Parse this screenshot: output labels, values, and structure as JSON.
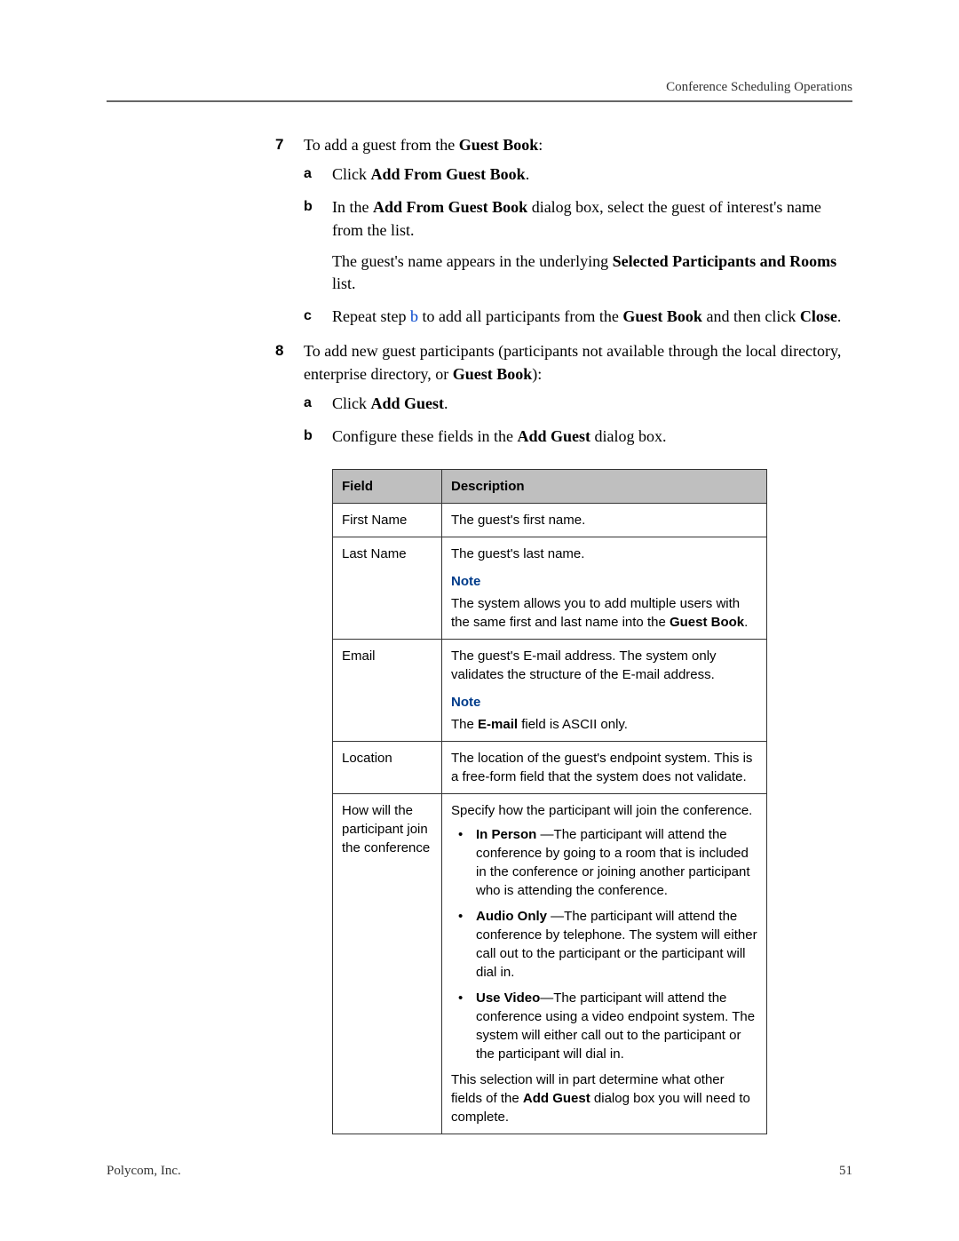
{
  "header": {
    "running_title": "Conference Scheduling Operations"
  },
  "steps": {
    "s7": {
      "num": "7",
      "intro_pre": "To add a guest from the ",
      "intro_bold": "Guest Book",
      "intro_post": ":",
      "a": {
        "letter": "a",
        "pre": "Click ",
        "bold": "Add From Guest Book",
        "post": "."
      },
      "b": {
        "letter": "b",
        "pre": "In the ",
        "bold": "Add From Guest Book",
        "post": " dialog box, select the guest of interest's name from the list.",
        "para2_pre": "The guest's name appears in the underlying ",
        "para2_bold": "Selected Participants and Rooms",
        "para2_post": " list."
      },
      "c": {
        "letter": "c",
        "text1": "Repeat step ",
        "link": "b",
        "text2": " to add all participants from the ",
        "bold1": "Guest Book",
        "text3": " and then click ",
        "bold2": "Close",
        "text4": "."
      }
    },
    "s8": {
      "num": "8",
      "intro_pre": "To add new guest participants (participants not available through the local directory, enterprise directory, or ",
      "intro_bold": "Guest Book",
      "intro_post": "):",
      "a": {
        "letter": "a",
        "pre": "Click ",
        "bold": "Add Guest",
        "post": "."
      },
      "b": {
        "letter": "b",
        "pre": "Configure these fields in the ",
        "bold": "Add Guest",
        "post": " dialog box."
      }
    }
  },
  "table": {
    "header": {
      "field": "Field",
      "desc": "Description"
    },
    "rows": {
      "first_name": {
        "field": "First Name",
        "desc": "The guest's first name."
      },
      "last_name": {
        "field": "Last Name",
        "desc": "The guest's last name.",
        "note_label": "Note",
        "note_pre": "The system allows you to add multiple users with the same first and last name into the ",
        "note_bold": "Guest Book",
        "note_post": "."
      },
      "email": {
        "field": "Email",
        "desc": "The guest's E-mail address. The system only validates the structure of the E-mail address.",
        "note_label": "Note",
        "note_pre": "The ",
        "note_bold": "E-mail",
        "note_post": " field is ASCII only."
      },
      "location": {
        "field": "Location",
        "desc": "The location of the guest's endpoint system. This is a free-form field that the system does not validate."
      },
      "join": {
        "field": "How will the participant join the conference",
        "intro": "Specify how the participant will join the conference.",
        "b1_bold": "In Person",
        "b1_text": " —The participant will attend the conference by going to a room that is included in the conference or joining another participant who is attending the conference.",
        "b2_bold": "Audio Only",
        "b2_text": " —The participant will attend the conference by telephone. The system will either call out to the participant or the participant will dial in.",
        "b3_bold": "Use Video",
        "b3_text": "—The participant will attend the conference using a video endpoint system. The system will either call out to the participant or the participant will dial in.",
        "tail_pre": "This selection will in part determine what other fields of the ",
        "tail_bold": "Add Guest",
        "tail_post": " dialog box you will need to complete."
      }
    }
  },
  "footer": {
    "left": "Polycom, Inc.",
    "right": "51"
  }
}
